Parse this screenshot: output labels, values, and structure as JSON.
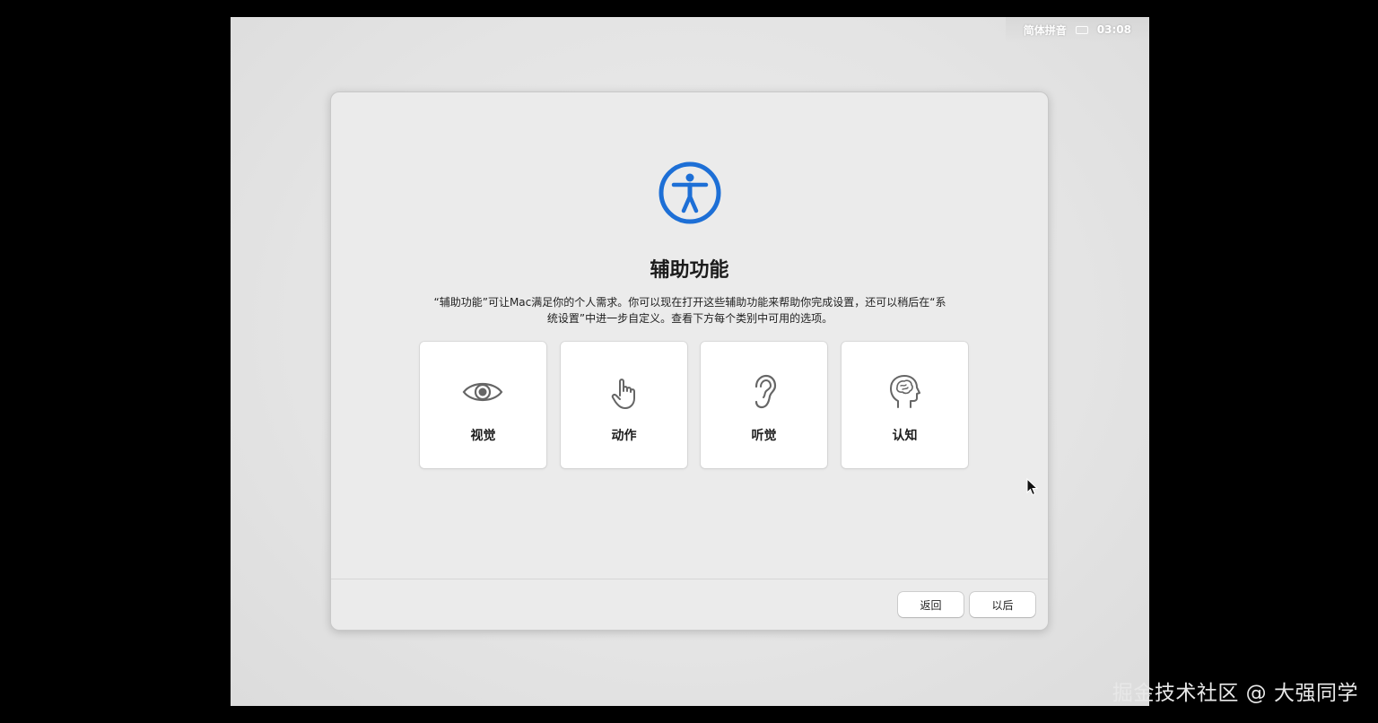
{
  "statusbar": {
    "input_method": "简体拼音",
    "keyboard_icon": "keyboard-icon",
    "time": "03:08"
  },
  "dialog": {
    "icon": "accessibility-icon",
    "accent_color": "#1d6fd6",
    "title": "辅助功能",
    "description_line1": "“辅助功能”可让Mac满足你的个人需求。你可以现在打开这些辅助功能来帮助你完成设置，还可以稍后在“系",
    "description_line2": "统设置”中进一步自定义。查看下方每个类别中可用的选项。",
    "categories": [
      {
        "label": "视觉",
        "icon": "eye-icon"
      },
      {
        "label": "动作",
        "icon": "hand-pointer-icon"
      },
      {
        "label": "听觉",
        "icon": "ear-icon"
      },
      {
        "label": "认知",
        "icon": "brain-head-icon"
      }
    ],
    "back_label": "返回",
    "later_label": "以后"
  },
  "watermark": "掘金技术社区 @ 大强同学"
}
